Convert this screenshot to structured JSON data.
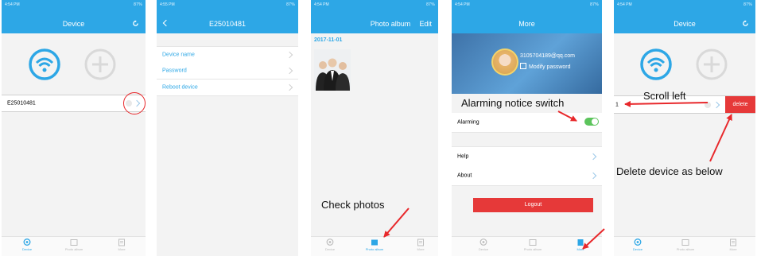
{
  "status": {
    "time_1": "4:54 PM",
    "time_2": "4:55 PM",
    "time_3": "4:54 PM",
    "time_4": "4:54 PM",
    "time_5": "4:54 PM",
    "battery": "87%"
  },
  "screen1": {
    "title": "Device",
    "device_id": "E25010481"
  },
  "screen2": {
    "title": "E25010481",
    "items": [
      "Device name",
      "Password",
      "Reboot device"
    ]
  },
  "screen3": {
    "title": "Photo album",
    "edit": "Edit",
    "date": "2017-11-01"
  },
  "screen4": {
    "title": "More",
    "email": "3105704189@qq.com",
    "modify_password": "Modify password",
    "alarming": "Alarming",
    "help": "Help",
    "about": "About",
    "logout": "Logout"
  },
  "screen5": {
    "title": "Device",
    "device_partial": "1",
    "delete": "delete"
  },
  "tabs": {
    "device": "Device",
    "photo_album": "Photo album",
    "more": "More"
  },
  "annotations": {
    "check_photos": "Check photos",
    "alarming_switch": "Alarming notice switch",
    "scroll_left": "Scroll left",
    "delete_below": "Delete device as below"
  },
  "colors": {
    "brand": "#2da7e6",
    "delete": "#e63939",
    "toggle": "#5cc45c",
    "annotation_arrow": "#e8282b"
  }
}
